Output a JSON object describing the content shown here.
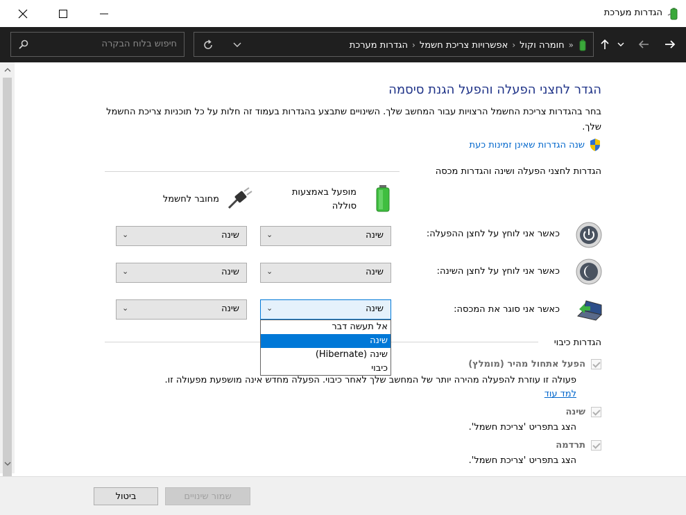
{
  "window": {
    "title": "הגדרות מערכת"
  },
  "address_bar": {
    "crumbs": [
      "חומרה וקול",
      "אפשרויות צריכת חשמל",
      "הגדרות מערכת"
    ],
    "overflow": "«",
    "search_placeholder": "חיפוש בלוח הבקרה"
  },
  "page": {
    "heading": "הגדר לחצני הפעלה והפעל הגנת סיסמה",
    "description": "בחר בהגדרות צריכת החשמל הרצויות עבור המחשב שלך. השינויים שתבצע בהגדרות בעמוד זה חלות על כל תוכניות צריכת החשמל שלך.",
    "change_link": "שנה הגדרות שאינן זמינות כעת"
  },
  "buttons_section": {
    "header": "הגדרות לחצני הפעלה ושינה והגדרות מכסה",
    "col_battery": "מופעל באמצעות סוללה",
    "col_plugged": "מחובר לחשמל",
    "rows": [
      {
        "label": "כאשר אני לוחץ על לחצן ההפעלה:",
        "battery": "שינה",
        "plugged": "שינה"
      },
      {
        "label": "כאשר אני לוחץ על לחצן השינה:",
        "battery": "שינה",
        "plugged": "שינה"
      },
      {
        "label": "כאשר אני סוגר את המכסה:",
        "battery": "שינה",
        "plugged": "שינה"
      }
    ]
  },
  "dropdown": {
    "options": [
      "אל תעשה דבר",
      "שינה",
      "שינה (Hibernate)",
      "כיבוי"
    ],
    "selected_index": 1
  },
  "shutdown_section": {
    "header": "הגדרות כיבוי",
    "fast_startup_title": "הפעל אתחול מהיר (מומלץ)",
    "fast_startup_desc": "פעולה זו עוזרת להפעלה מהירה יותר של המחשב שלך לאחר כיבוי. הפעלה מחדש אינה מושפעת מפעולה זו.",
    "learn_more": "למד עוד",
    "sleep_title": "שינה",
    "sleep_desc": "הצג בתפריט 'צריכת חשמל'.",
    "hibernate_title": "תרדמה",
    "hibernate_desc": "הצג בתפריט 'צריכת חשמל'."
  },
  "footer": {
    "save_label": "שמור שינויים",
    "cancel_label": "ביטול"
  },
  "colors": {
    "heading": "#1e3287",
    "link": "#0066cc",
    "selection": "#0078d7",
    "address_bar_bg": "#1f1f1f"
  }
}
